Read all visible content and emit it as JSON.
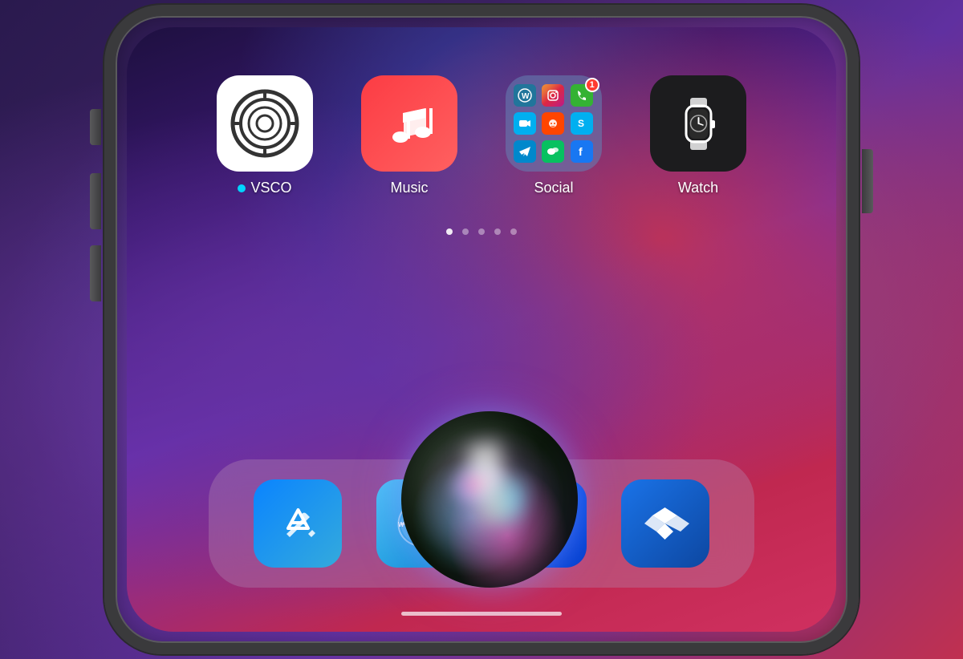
{
  "phone": {
    "screen": {
      "apps": [
        {
          "id": "vsco",
          "label": "VSCO",
          "has_dot": true,
          "dot_color": "#00d4ff"
        },
        {
          "id": "music",
          "label": "Music",
          "has_dot": false
        },
        {
          "id": "social",
          "label": "Social",
          "badge": "1",
          "has_dot": false
        },
        {
          "id": "watch",
          "label": "Watch",
          "has_dot": false
        }
      ],
      "page_dots": [
        {
          "active": true
        },
        {
          "active": false
        },
        {
          "active": false
        },
        {
          "active": false
        },
        {
          "active": false
        }
      ],
      "dock": {
        "apps": [
          {
            "id": "appstore",
            "label": "App Store"
          },
          {
            "id": "safari",
            "label": "Safari"
          },
          {
            "id": "mail",
            "label": "Mail"
          },
          {
            "id": "dropbox",
            "label": "Dropbox"
          }
        ]
      },
      "siri": {
        "active": true
      }
    }
  },
  "social_apps": [
    {
      "color": "#21759b",
      "symbol": "W"
    },
    {
      "color": "#e1306c",
      "symbol": "📷"
    },
    {
      "color": "#34b233",
      "symbol": "📞"
    },
    {
      "color": "#00aff0",
      "symbol": "▶"
    },
    {
      "color": "#ff4500",
      "symbol": "●"
    },
    {
      "color": "#00aff0",
      "symbol": "S"
    },
    {
      "color": "#0088cc",
      "symbol": "✈"
    },
    {
      "color": "#07c160",
      "symbol": "💬"
    },
    {
      "color": "#1877f2",
      "symbol": "f"
    }
  ]
}
